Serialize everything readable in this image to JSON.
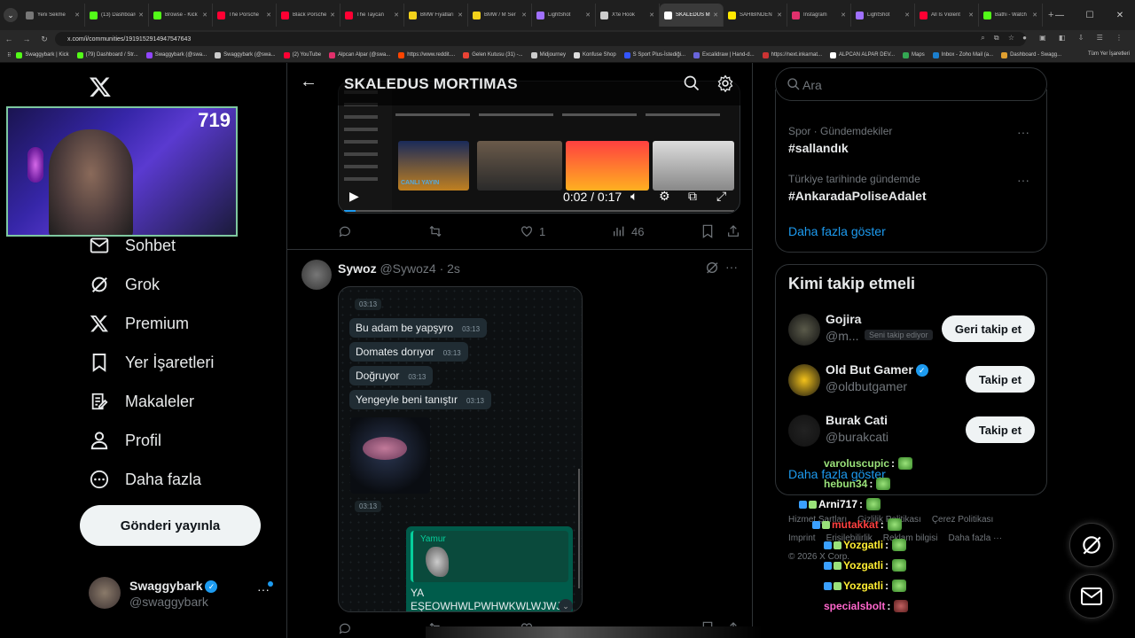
{
  "browser": {
    "tabs": [
      {
        "title": "Yeni Sekme",
        "color": "#777777"
      },
      {
        "title": "(13) Dashboard",
        "color": "#53fc18"
      },
      {
        "title": "Browse - Kick",
        "color": "#53fc18"
      },
      {
        "title": "The Porsche",
        "color": "#ff0033"
      },
      {
        "title": "Black Porsche",
        "color": "#ff0033"
      },
      {
        "title": "The Taycan",
        "color": "#ff0033"
      },
      {
        "title": "BMW Fiyatları",
        "color": "#f3d21b"
      },
      {
        "title": "BMW / M Ser",
        "color": "#f3d21b"
      },
      {
        "title": "LightShot",
        "color": "#a070ff"
      },
      {
        "title": "X'te Hook",
        "color": "#cccccc"
      },
      {
        "title": "SKALEDUS M",
        "color": "#ffffff",
        "active": true
      },
      {
        "title": "SAHİBİNDEN",
        "color": "#ffe800"
      },
      {
        "title": "Instagram",
        "color": "#e1306c"
      },
      {
        "title": "LightShot",
        "color": "#a070ff"
      },
      {
        "title": "All Is Violent",
        "color": "#ff0033"
      },
      {
        "title": "Bathi - Watch",
        "color": "#53fc18"
      }
    ],
    "url": "x.com/i/communities/1919152914947547643",
    "bookmarks": [
      {
        "label": "Swaggybark | Kick",
        "color": "#53fc18"
      },
      {
        "label": "(79) Dashboard / Str...",
        "color": "#53fc18"
      },
      {
        "label": "Swaggybark (@swa...",
        "color": "#9146ff"
      },
      {
        "label": "Swaggybark (@swa...",
        "color": "#cccccc"
      },
      {
        "label": "(2) YouTube",
        "color": "#ff0033"
      },
      {
        "label": "Alpcan Alpar (@swa...",
        "color": "#e1306c"
      },
      {
        "label": "https://www.reddit....",
        "color": "#ff4500"
      },
      {
        "label": "Gelen Kutusu (31) -...",
        "color": "#ea4335"
      },
      {
        "label": "Midjourney",
        "color": "#cccccc"
      },
      {
        "label": "Konfuse Shop",
        "color": "#dddddd"
      },
      {
        "label": "S Sport Plus-İstediği...",
        "color": "#3355ff"
      },
      {
        "label": "Excalidraw | Hand-d...",
        "color": "#6965db"
      },
      {
        "label": "https://next.inkarnat...",
        "color": "#cc3333"
      },
      {
        "label": "ALPCAN ALPAR DEV...",
        "color": "#ffffff"
      },
      {
        "label": "Maps",
        "color": "#34a853"
      },
      {
        "label": "Inbox - Zoho Mail (a...",
        "color": "#1b7fce"
      },
      {
        "label": "Dashboard - Swagg...",
        "color": "#e0a030"
      }
    ],
    "bookmarks_all": "Tüm Yer İşaretleri"
  },
  "stream": {
    "viewer_count": "719"
  },
  "nav": {
    "items": [
      {
        "label": "Sohbet",
        "icon": "mail-icon"
      },
      {
        "label": "Grok",
        "icon": "grok-icon"
      },
      {
        "label": "Premium",
        "icon": "x-icon"
      },
      {
        "label": "Yer İşaretleri",
        "icon": "bookmark-icon"
      },
      {
        "label": "Makaleler",
        "icon": "article-icon"
      },
      {
        "label": "Profil",
        "icon": "person-icon"
      },
      {
        "label": "Daha fazla",
        "icon": "more-circle-icon"
      }
    ],
    "post_button": "Gönderi yayınla"
  },
  "account": {
    "name": "Swaggybark",
    "handle": "@swaggybark",
    "more": "···"
  },
  "header": {
    "title": "SKALEDUS MORTIMAS"
  },
  "video": {
    "live_label": "CANLI YAYIN",
    "time": "0:02 / 0:17",
    "progress": 0.03
  },
  "post1": {
    "likes": "1",
    "views": "46"
  },
  "post2": {
    "name": "Sywoz",
    "handle": "@Sywoz4 · 2s",
    "messages": [
      {
        "text": "Bu adam be yapşyro",
        "time": "03:13"
      },
      {
        "text": "Domates dorıyor",
        "time": "03:13"
      },
      {
        "text": "Doğruyor",
        "time": "03:13"
      },
      {
        "text": "Yengeyle beni tanıştır",
        "time": "03:13"
      }
    ],
    "timestamp_top": "03:13",
    "timestamp_sticker": "03:13",
    "reply_quote_name": "Yamur",
    "reply_text_1": "YA",
    "reply_text_2": "EŞEOWHWLPWHWKWLWJWJW"
  },
  "search": {
    "placeholder": "Ara"
  },
  "trends": [
    {
      "category": "Spor · Gündemdekiler",
      "tag": "#sallandık"
    },
    {
      "category": "Türkiye tarihinde gündemde",
      "tag": "#AnkaradaPoliseAdalet"
    }
  ],
  "trends_more": "Daha fazla göster",
  "who_to_follow": {
    "title": "Kimi takip etmeli",
    "users": [
      {
        "name": "Gojira",
        "handle": "@m...",
        "follows_you": "Seni takip ediyor",
        "button": "Geri takip et",
        "color": "#5a5a4a"
      },
      {
        "name": "Old But Gamer",
        "handle": "@oldbutgamer",
        "button": "Takip et",
        "color": "#f3c21b",
        "verified": true
      },
      {
        "name": "Burak Cati",
        "handle": "@burakcati",
        "button": "Takip et",
        "color": "#222222"
      }
    ],
    "more": "Daha fazla göster"
  },
  "footer": {
    "links": [
      "Hizmet Şartları",
      "Gizlilik Politikası",
      "Çerez Politikası",
      "Imprint",
      "Erişilebilirlik",
      "Reklam bilgisi",
      "Daha fazla ···"
    ],
    "copyright": "© 2026 X Corp."
  },
  "stream_chat": [
    {
      "user": "varoluscupic",
      "color": "#9ae27a"
    },
    {
      "user": "hebun34",
      "color": "#9ae27a"
    },
    {
      "user": "Arni717",
      "color": "#ffffff"
    },
    {
      "user": "mutakkat",
      "color": "#ff4040"
    },
    {
      "user": "Yozgatli",
      "color": "#ffee33"
    },
    {
      "user": "Yozgatli",
      "color": "#ffee33"
    },
    {
      "user": "Yozgatli",
      "color": "#ffee33"
    },
    {
      "user": "specialsbolt",
      "color": "#ff66cc"
    }
  ],
  "colors": {
    "accent": "#1d9bf0",
    "whatsapp_green": "#005c4b"
  }
}
